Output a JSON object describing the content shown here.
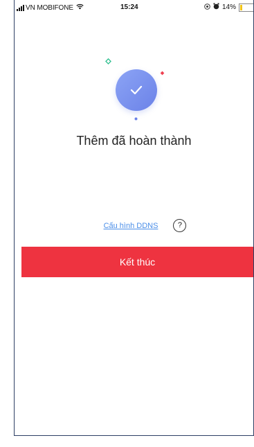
{
  "status_bar": {
    "carrier": "VN MOBIFONE",
    "time": "15:24",
    "battery_percent": "14%",
    "battery_level": 0.14,
    "icons": [
      "signal-icon",
      "wifi-icon",
      "location-icon",
      "alarm-icon",
      "battery-icon"
    ]
  },
  "main": {
    "title": "Thêm đã hoàn thành",
    "ddns_link": "Cấu hình DDNS",
    "help_symbol": "?",
    "finish_button": "Kết thúc"
  },
  "colors": {
    "accent_red": "#ee3340",
    "link_blue": "#4a8ee8",
    "success_circle": "#7b93ee"
  }
}
